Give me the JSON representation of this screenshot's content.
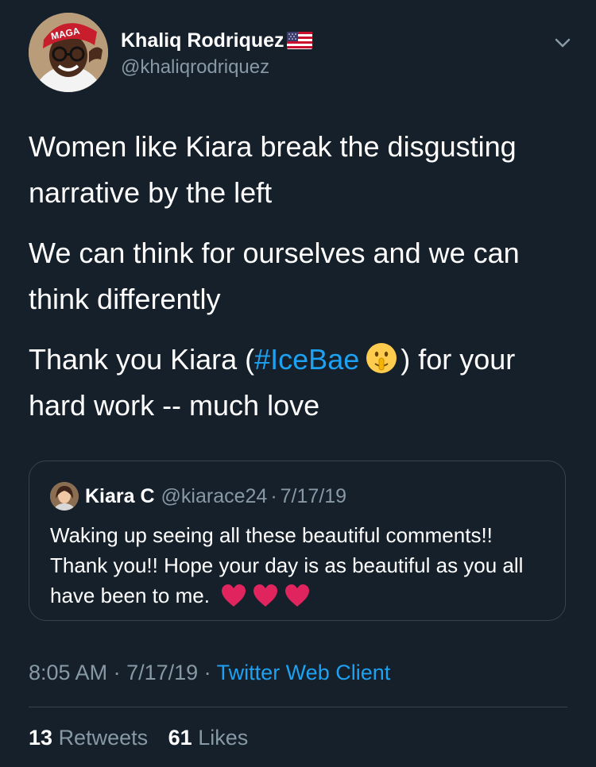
{
  "tweet": {
    "author": {
      "display_name": "Khaliq Rodriquez",
      "flag_icon": "us-flag-icon",
      "handle": "@khaliqrodriquez",
      "avatar_hat_text": "MAGA",
      "menu_icon": "chevron-down-icon"
    },
    "body": {
      "paragraph_1": "Women like Kiara break the disgusting narrative by the left",
      "paragraph_2": "We can think for ourselves and we can think differently",
      "paragraph_3_before": "Thank you Kiara (",
      "hashtag": "#IceBae",
      "emoji": "shushing-face-emoji",
      "paragraph_3_after": ") for your hard work -- much love"
    },
    "quoted_tweet": {
      "display_name": "Kiara C",
      "handle": "@kiarace24",
      "separator": "·",
      "date": "7/17/19",
      "text": "Waking up seeing all these beautiful comments!! Thank you!! Hope your day is as beautiful as you all have been to me.",
      "emojis": [
        "heart-icon",
        "heart-icon",
        "heart-icon"
      ]
    },
    "meta": {
      "time": "8:05 AM",
      "separator_1": " · ",
      "date": "7/17/19",
      "separator_2": " · ",
      "client": "Twitter Web Client"
    },
    "stats": {
      "retweets_count": "13",
      "retweets_label": "Retweets",
      "likes_count": "61",
      "likes_label": "Likes"
    },
    "colors": {
      "background": "#15202b",
      "primary_text": "#ffffff",
      "secondary_text": "#8899a6",
      "accent": "#1da1f2",
      "border": "#38444d",
      "heart": "#e0245e"
    }
  }
}
